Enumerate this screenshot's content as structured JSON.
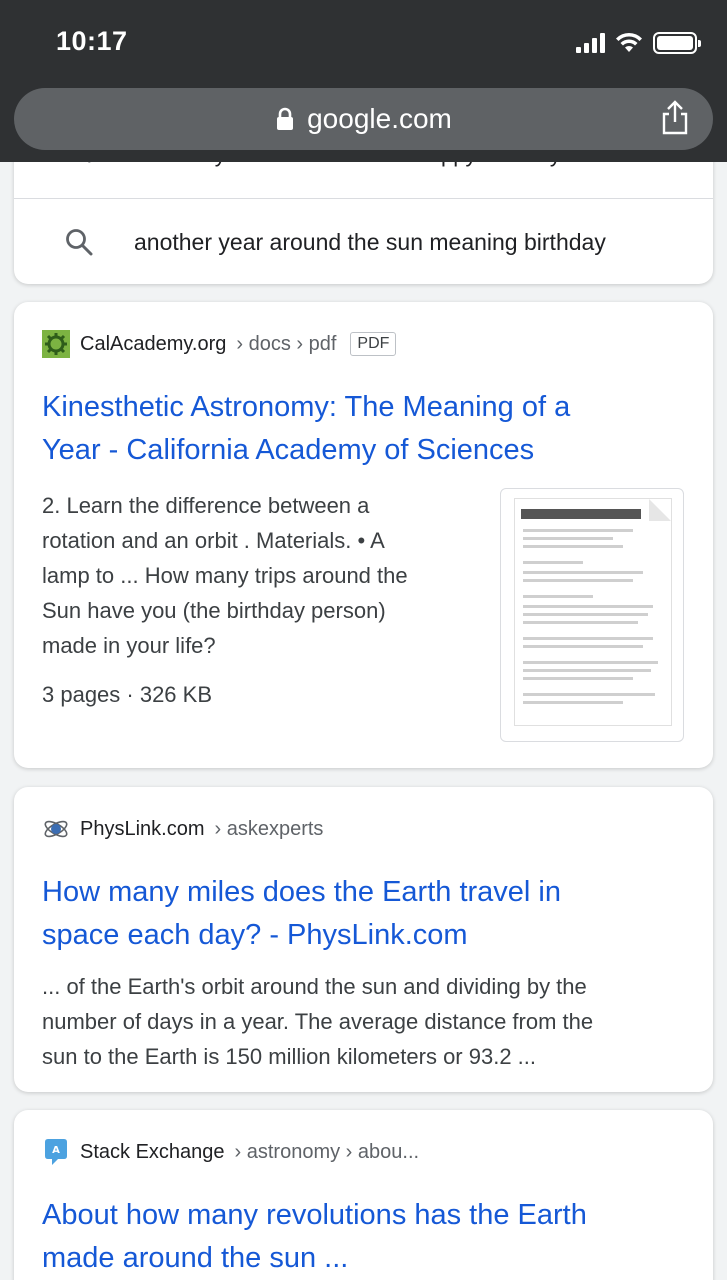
{
  "status": {
    "time": "10:17"
  },
  "browser": {
    "url": "google.com"
  },
  "related": {
    "cut_text": "another year around the sun happy birthday",
    "query": "another year around the sun meaning birthday"
  },
  "results": [
    {
      "site": "CalAcademy.org",
      "crumbs": "› docs › pdf",
      "badge": "PDF",
      "title_line1": "Kinesthetic Astronomy: The Meaning of a",
      "title_line2": "Year - California Academy of Sciences",
      "snippet": [
        "2. Learn the difference between a",
        "rotation and an orbit . Materials. • A",
        "lamp to ... How many trips around the",
        "Sun have you (the birthday person)",
        "made in your life?"
      ],
      "meta": "3 pages · 326 KB",
      "thumb_title": "Kinesthetic Astronomy: The Meaning of a Year",
      "favicon": "gear-icon",
      "favicon_color": "#7cb342"
    },
    {
      "site": "PhysLink.com",
      "crumbs": "› askexperts",
      "title_line1": "How many miles does the Earth travel in",
      "title_line2": "space each day? - PhysLink.com",
      "snippet": [
        "... of the Earth's orbit around the sun and dividing by the",
        "number of days in a year. The average distance from the",
        "sun to the Earth is 150 million kilometers or 93.2 ..."
      ],
      "favicon": "atom-icon"
    },
    {
      "site": "Stack Exchange",
      "crumbs": "› astronomy › abou...",
      "title_line1": "About how many revolutions has the Earth",
      "title_line2": "made around the sun ...",
      "favicon": "stack-exchange-icon",
      "favicon_color": "#4ca2e0"
    }
  ],
  "colors": {
    "link": "#1558d6",
    "chrome": "#2f3133",
    "urlbar": "#5f6265"
  }
}
